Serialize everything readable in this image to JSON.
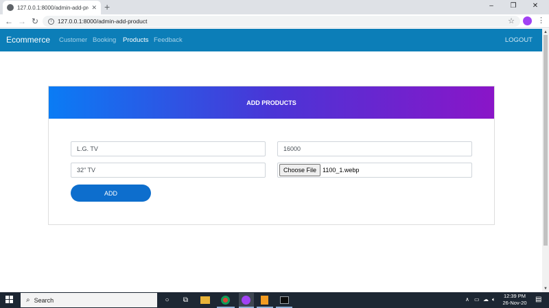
{
  "browser": {
    "tab_title": "127.0.0.1:8000/admin-add-produ",
    "tab_close": "✕",
    "new_tab": "+",
    "url": "127.0.0.1:8000/admin-add-product",
    "window_minimize": "–",
    "window_restore": "❐",
    "window_close": "✕"
  },
  "navbar": {
    "brand": "Ecommerce",
    "links": [
      "Customer",
      "Booking",
      "Products",
      "Feedback"
    ],
    "active_link": "Products",
    "logout": "LOGOUT"
  },
  "form": {
    "title": "ADD PRODUCTS",
    "name_value": "L.G. TV",
    "price_value": "16000",
    "description_value": "32\" TV",
    "choose_file_label": "Choose File",
    "file_name": "1100_1.webp",
    "submit_label": "ADD"
  },
  "taskbar": {
    "search_placeholder": "Search",
    "time": "12:39 PM",
    "date": "26-Nov-20"
  },
  "colors": {
    "navbar": "#0c7eb8",
    "header_gradient_start": "#0a7cf5",
    "header_gradient_end": "#8a15c8",
    "button": "#0d6ecd"
  }
}
